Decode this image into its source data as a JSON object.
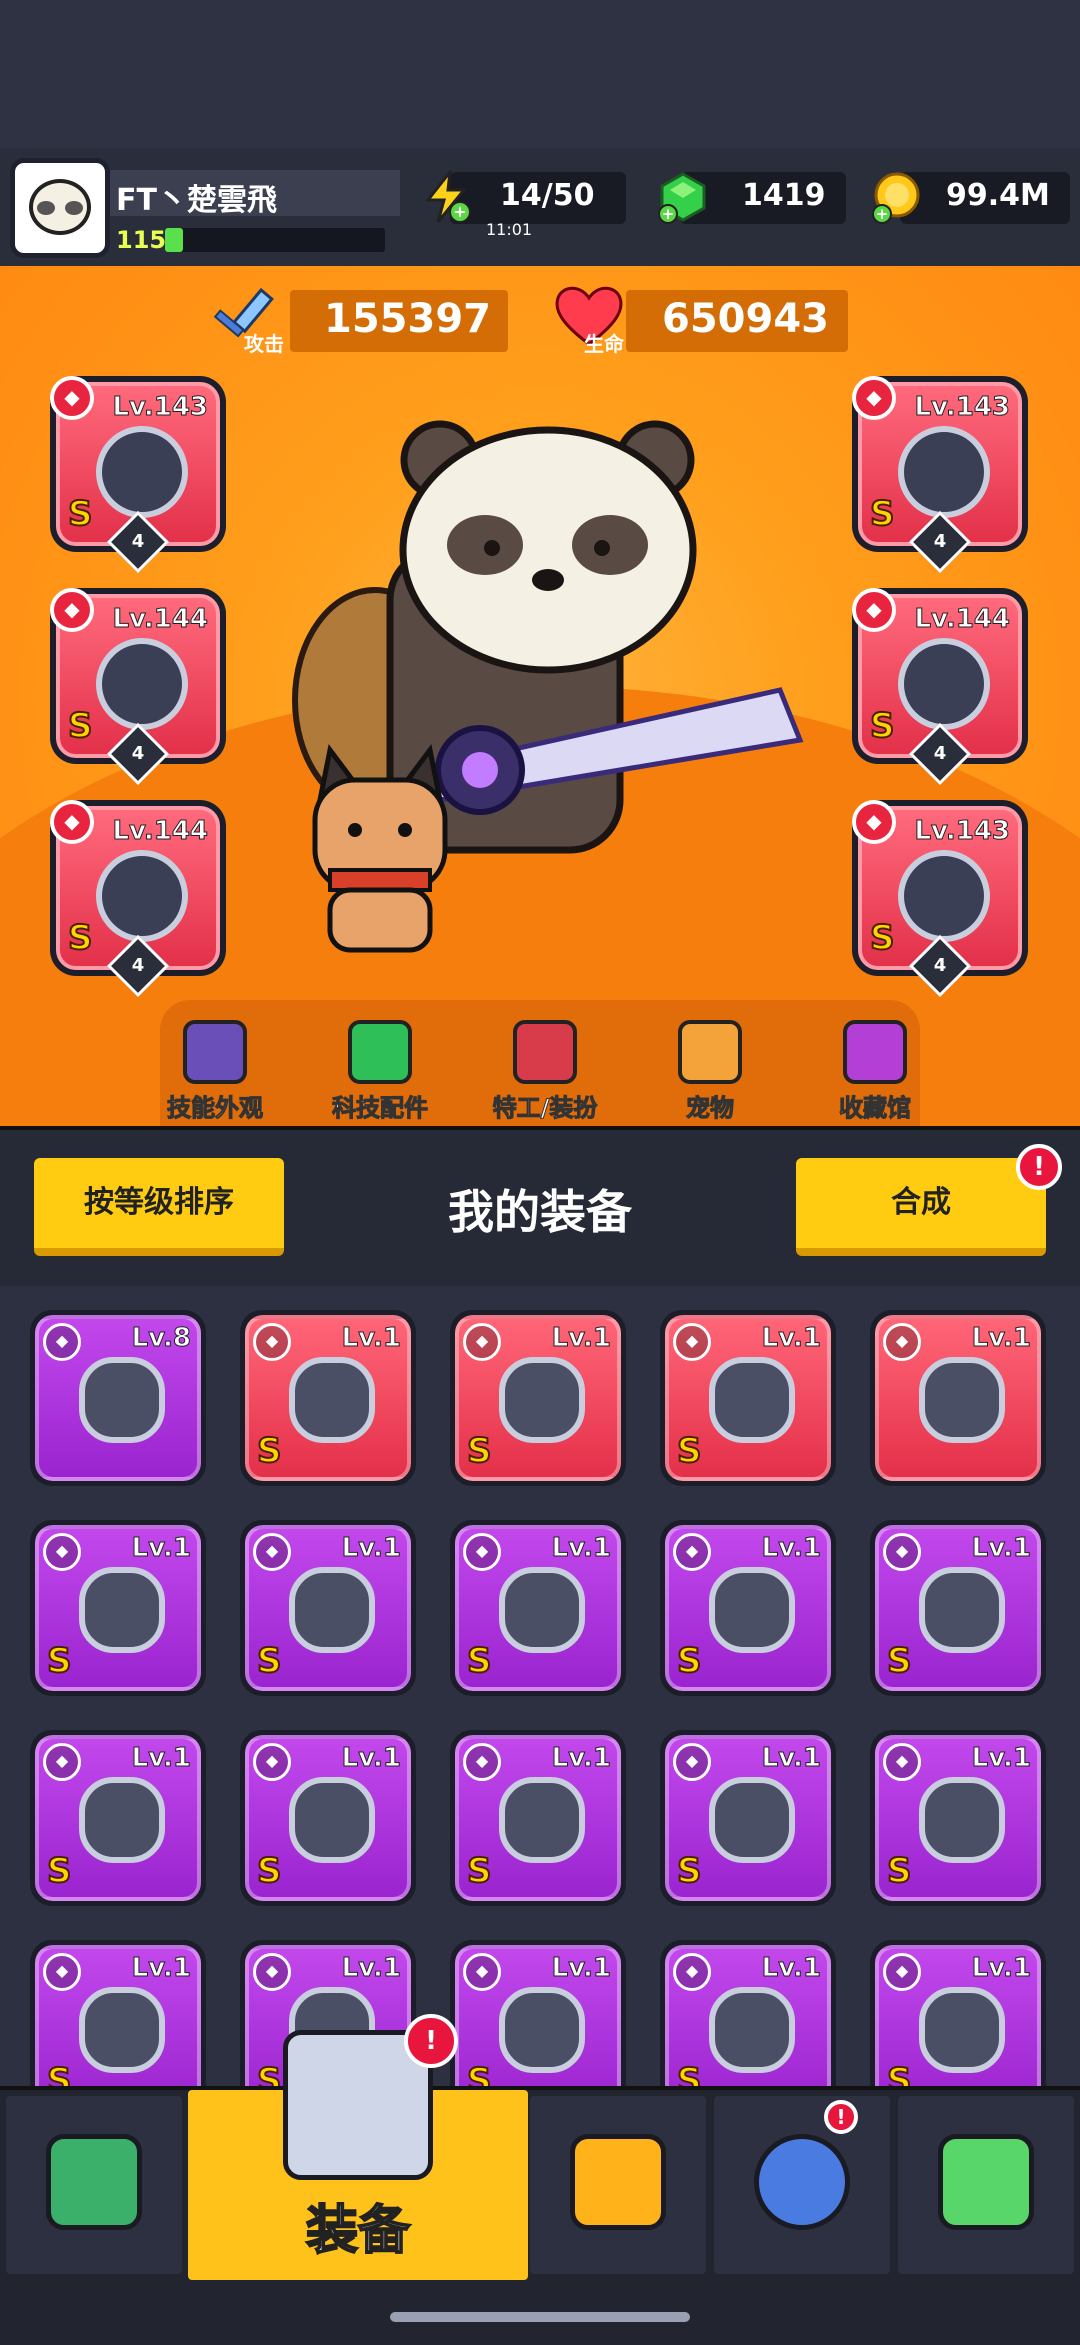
{
  "player": {
    "name": "FT丶楚雲飛",
    "level": "115",
    "xp_fraction": 0.08
  },
  "resources": {
    "energy": {
      "value": "14/50",
      "timer": "11:01",
      "icon": "lightning-icon"
    },
    "gems": {
      "value": "1419",
      "icon": "green-gem-icon"
    },
    "coins": {
      "value": "99.4M",
      "icon": "gold-coin-icon"
    }
  },
  "stats": {
    "attack": {
      "label": "攻击",
      "value": "155397",
      "icon": "sword-icon"
    },
    "health": {
      "label": "生命",
      "value": "650943",
      "icon": "heart-icon"
    }
  },
  "equipped": {
    "left": [
      {
        "slot": "weapon",
        "level": "Lv.143",
        "grade": "S",
        "stars": "4",
        "icon": "spiked-blade-icon"
      },
      {
        "slot": "necklace",
        "level": "Lv.144",
        "grade": "S",
        "stars": "4",
        "icon": "star-necklace-icon"
      },
      {
        "slot": "gloves",
        "level": "Lv.144",
        "grade": "S",
        "stars": "4",
        "icon": "gauntlet-icon"
      }
    ],
    "right": [
      {
        "slot": "armor",
        "level": "Lv.143",
        "grade": "S",
        "stars": "4",
        "icon": "mech-armor-icon"
      },
      {
        "slot": "belt",
        "level": "Lv.144",
        "grade": "S",
        "stars": "4",
        "icon": "belt-icon"
      },
      {
        "slot": "boots",
        "level": "Lv.143",
        "grade": "S",
        "stars": "4",
        "icon": "boots-icon"
      }
    ]
  },
  "hero_tabs": [
    {
      "label": "技能外观",
      "icon": "skin-hat-icon"
    },
    {
      "label": "科技配件",
      "icon": "tech-chip-icon"
    },
    {
      "label": "特工/装扮",
      "icon": "agent-icon"
    },
    {
      "label": "宠物",
      "icon": "pet-dog-icon"
    },
    {
      "label": "收藏馆",
      "icon": "collection-chest-icon"
    }
  ],
  "equipment_panel": {
    "title": "我的装备",
    "sort_button": "按等级排序",
    "merge_button": "合成",
    "merge_alert": "!"
  },
  "inventory": [
    {
      "level": "Lv.8",
      "grade": "",
      "color": "purple",
      "icon": "gauntlet-icon"
    },
    {
      "level": "Lv.1",
      "grade": "S",
      "color": "red",
      "icon": "flame-sword-icon"
    },
    {
      "level": "Lv.1",
      "grade": "S",
      "color": "red",
      "icon": "belt-icon"
    },
    {
      "level": "Lv.1",
      "grade": "S",
      "color": "red",
      "icon": "boots-icon"
    },
    {
      "level": "Lv.1",
      "grade": "",
      "color": "red",
      "icon": "kunai-icon"
    },
    {
      "level": "Lv.1",
      "grade": "S",
      "color": "purple",
      "icon": "flame-sword-icon"
    },
    {
      "level": "Lv.1",
      "grade": "S",
      "color": "purple",
      "icon": "spiked-blade-icon"
    },
    {
      "level": "Lv.1",
      "grade": "S",
      "color": "purple",
      "icon": "spiked-blade-icon"
    },
    {
      "level": "Lv.1",
      "grade": "S",
      "color": "purple",
      "icon": "dark-armor-icon"
    },
    {
      "level": "Lv.1",
      "grade": "S",
      "color": "purple",
      "icon": "dark-armor-icon"
    },
    {
      "level": "Lv.1",
      "grade": "S",
      "color": "purple",
      "icon": "silver-armor-icon"
    },
    {
      "level": "Lv.1",
      "grade": "S",
      "color": "purple",
      "icon": "silver-armor-icon"
    },
    {
      "level": "Lv.1",
      "grade": "S",
      "color": "purple",
      "icon": "silver-armor-icon"
    },
    {
      "level": "Lv.1",
      "grade": "S",
      "color": "purple",
      "icon": "silver-armor-icon"
    },
    {
      "level": "Lv.1",
      "grade": "S",
      "color": "purple",
      "icon": "silver-armor-icon"
    },
    {
      "level": "Lv.1",
      "grade": "S",
      "color": "purple",
      "icon": "silver-armor-icon"
    },
    {
      "level": "Lv.1",
      "grade": "S",
      "color": "purple",
      "icon": "halo-necklace-icon"
    },
    {
      "level": "Lv.1",
      "grade": "S",
      "color": "purple",
      "icon": "chain-necklace-icon"
    },
    {
      "level": "Lv.1",
      "grade": "S",
      "color": "purple",
      "icon": "spiked-necklace-icon"
    },
    {
      "level": "Lv.1",
      "grade": "S",
      "color": "purple",
      "icon": "spiked-necklace-icon"
    }
  ],
  "bottom_nav": [
    {
      "label": "",
      "icon": "shop-icon"
    },
    {
      "label": "装备",
      "icon": "equipment-icon",
      "alert": "!"
    },
    {
      "label": "",
      "icon": "swords-star-icon"
    },
    {
      "label": "",
      "icon": "world-ball-icon",
      "alert": "!"
    },
    {
      "label": "",
      "icon": "dna-capsule-icon"
    }
  ],
  "colors": {
    "accent": "#ffc21a",
    "stage": "#ff9f1c",
    "rare_red": "#e4304a",
    "epic_purple": "#9a24cf"
  }
}
